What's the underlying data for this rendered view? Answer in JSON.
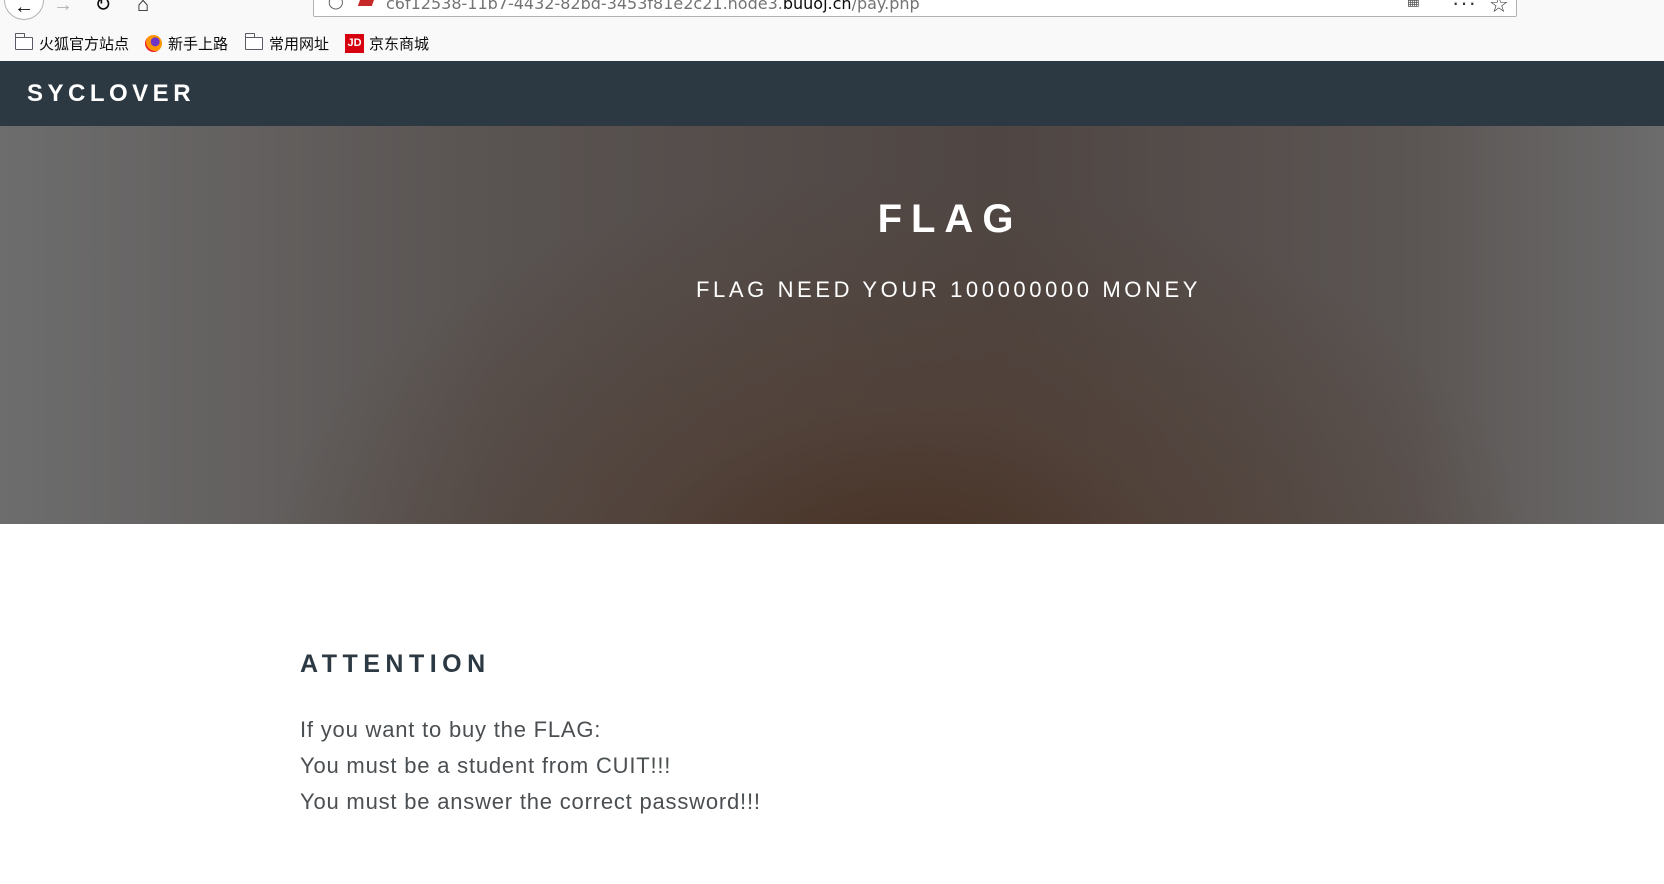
{
  "browser": {
    "url_prefix": "c6f12538-11b7-4432-82bd-3453f81e2c21.node3.",
    "url_host": "buuoj.cn",
    "url_path": "/pay.php",
    "bookmarks": [
      {
        "label": "火狐官方站点",
        "icon": "folder-icon"
      },
      {
        "label": "新手上路",
        "icon": "firefox-icon"
      },
      {
        "label": "常用网址",
        "icon": "folder-icon"
      },
      {
        "label": "京东商城",
        "icon": "jd-icon",
        "icon_text": "JD"
      }
    ]
  },
  "site": {
    "brand": "SYCLOVER",
    "hero": {
      "title": "FLAG",
      "subtitle": "FLAG NEED YOUR 100000000 MONEY"
    },
    "attention": {
      "title": "ATTENTION",
      "lines": [
        "If you want to buy the FLAG:",
        "You must be a student from CUIT!!!",
        "You must be answer the correct password!!!"
      ]
    }
  },
  "colors": {
    "navbar": "#2c3842",
    "heading": "#2c3842",
    "body_text": "#4b4f52"
  }
}
